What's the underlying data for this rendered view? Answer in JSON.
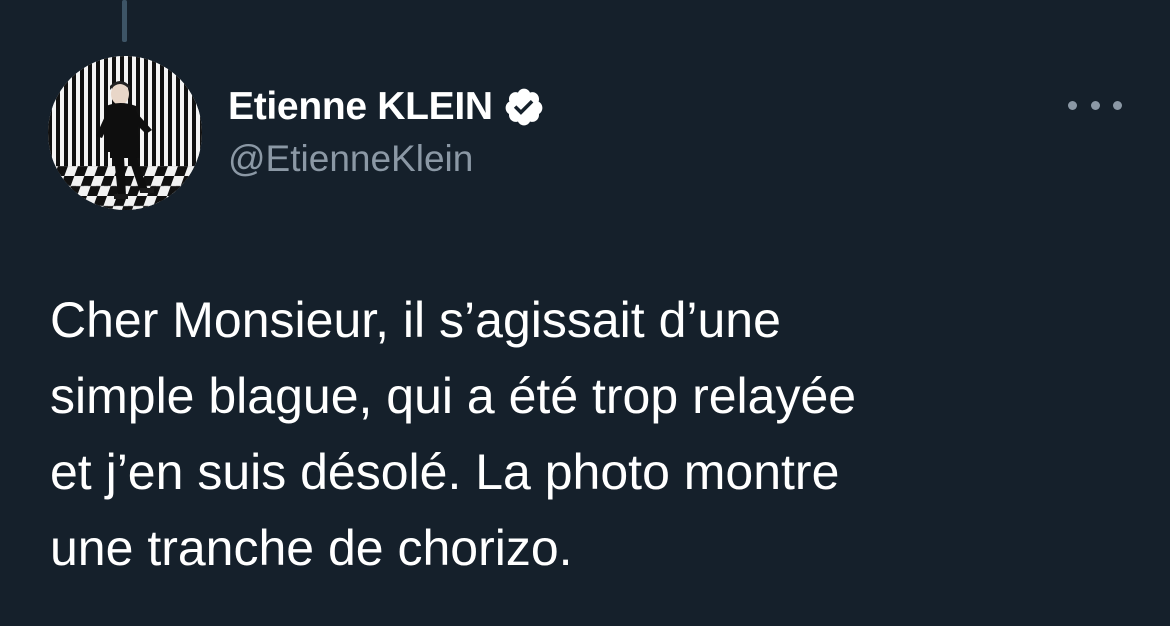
{
  "tweet": {
    "author": {
      "display_name": "Etienne KLEIN",
      "handle": "@EtienneKlein",
      "verified": true,
      "avatar_icon": "profile-photo"
    },
    "more_icon": "ellipsis-icon",
    "text": "Cher Monsieur, il s’agissait d’une\nsimple blague, qui a été trop relayée\net j’en suis désolé. La photo montre\nune tranche de chorizo."
  },
  "colors": {
    "background": "#15202b",
    "text_primary": "#ffffff",
    "text_secondary": "#8b98a5",
    "thread_line": "#3d5466"
  }
}
